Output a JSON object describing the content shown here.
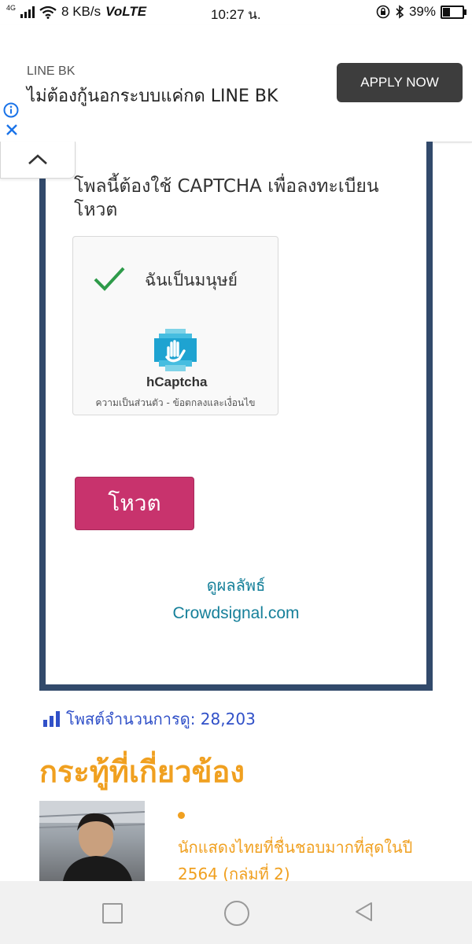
{
  "status_bar": {
    "network": "4G",
    "speed": "8 KB/s",
    "volte": "VoLTE",
    "time": "10:27 น.",
    "battery": "39%",
    "battery_level": 0.39,
    "icons": [
      "signal-icon",
      "wifi-icon",
      "lock-rotation-icon",
      "bluetooth-icon",
      "battery-icon"
    ]
  },
  "ad": {
    "brand": "LINE BK",
    "text": "ไม่ต้องกู้นอกระบบแค่กด LINE BK",
    "cta": "APPLY NOW",
    "info_color": "#1a73e8",
    "close_color": "#1a73e8"
  },
  "poll": {
    "captcha_note": "โพลนี้ต้องใช้ CAPTCHA เพื่อลงทะเบียนโหวต",
    "captcha_checkbox_label": "ฉันเป็นมนุษย์",
    "captcha_brand": "hCaptcha",
    "captcha_links": "ความเป็นส่วนตัว - ข้อตกลงและเงื่อนไข",
    "vote_button": "โหวต",
    "results_link": "ดูผลลัพธ์",
    "crowdsignal_link": "Crowdsignal.com",
    "border_color": "#324a6b",
    "button_color": "#c8336d",
    "link_color": "#16809a"
  },
  "post_views": "โพสต์จำนวนการดู: 28,203",
  "related": {
    "title": "กระทู้ที่เกี่ยวข้อง",
    "items": [
      {
        "title": "นักแสดงไทยที่ชื่นชอบมากที่สุดในปี 2564 (กล่มที่ 2)"
      }
    ],
    "accent_color": "#f0a020"
  }
}
